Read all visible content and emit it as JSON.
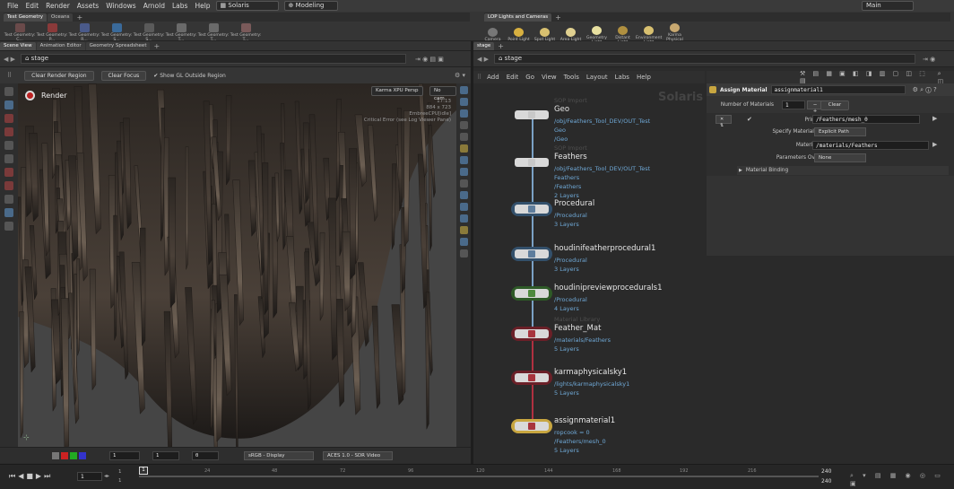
{
  "menubar": {
    "items": [
      "File",
      "Edit",
      "Render",
      "Assets",
      "Windows",
      "Arnold",
      "Labs",
      "Help"
    ],
    "desktop": "Solaris",
    "workspace": "Modeling",
    "right_desktop": "Main"
  },
  "shelf": {
    "left_tabs": [
      "Test Geometry",
      "Oceans"
    ],
    "left_tools": [
      "Test Geometry: C...",
      "Test Geometry: P...",
      "Test Geometry: R...",
      "Test Geometry: S...",
      "Test Geometry: S...",
      "Test Geometry: T...",
      "Test Geometry: T...",
      "Test Geometry: T..."
    ],
    "right_tabs": [
      "LOP Lights and Cameras"
    ],
    "right_tools": [
      "Camera",
      "Point Light",
      "Spot Light",
      "Area Light",
      "Geometry Light",
      "Distant Light",
      "Environment Light",
      "Karma Physical Sky..."
    ]
  },
  "left_pane": {
    "tabs": [
      "Scene View",
      "Animation Editor",
      "Geometry Spreadsheet"
    ],
    "path": "stage",
    "clear_render_region": "Clear Render Region",
    "clear_focus": "Clear Focus",
    "show_gl_outside": "Show GL Outside Region",
    "render_label": "Render",
    "renderer": "Karma XPU  Persp",
    "camera": "No cam",
    "overlay_lines": [
      "17:13",
      "884 x 723",
      "EmbreeCPU[idle]",
      "Critical Error (see Log Viewer Pane)"
    ],
    "bottom": {
      "frame_a": "1",
      "frame_b": "1",
      "frame_c": "0",
      "display": "sRGB - Display",
      "view": "ACES 1.0 - SDR Video"
    }
  },
  "right_pane": {
    "tab": "stage",
    "path": "stage",
    "menu": [
      "Add",
      "Edit",
      "Go",
      "View",
      "Tools",
      "Layout",
      "Labs",
      "Help"
    ],
    "watermark": "Solaris"
  },
  "nodes": [
    {
      "type": "SOP Import",
      "name": "Geo",
      "info": [
        "/obj/Feathers_Tool_DEV/OUT_Test",
        "Geo",
        "/Geo"
      ],
      "color": "#c8c8c8",
      "ring": "none"
    },
    {
      "type": "SOP Import",
      "name": "Feathers",
      "info": [
        "/obj/Feathers_Tool_DEV/OUT_Test",
        "Feathers",
        "/Feathers",
        "2 Layers"
      ],
      "color": "#c8c8c8",
      "ring": "none"
    },
    {
      "type": "",
      "name": "Procedural",
      "info": [
        "/Procedural",
        "3 Layers"
      ],
      "color": "#5e7d9c",
      "ring": "#33506b"
    },
    {
      "type": "",
      "name": "houdinifeatherprocedural1",
      "info": [
        "/Procedural",
        "3 Layers"
      ],
      "color": "#5e7d9c",
      "ring": "#33506b"
    },
    {
      "type": "",
      "name": "houdinipreviewprocedurals1",
      "info": [
        "/Procedural",
        "4 Layers"
      ],
      "color": "#4e8a3e",
      "ring": "#2e5a27"
    },
    {
      "type": "Material Library",
      "name": "Feather_Mat",
      "info": [
        "/materials/Feathers",
        "5 Layers"
      ],
      "color": "#a8343d",
      "ring": "#6b2028"
    },
    {
      "type": "",
      "name": "karmaphysicalsky1",
      "info": [
        "/lights/karmaphysicalsky1",
        "5 Layers"
      ],
      "color": "#a8343d",
      "ring": "#6b2028"
    },
    {
      "type": "",
      "name": "assignmaterial1",
      "info": [
        "ropcook = 0",
        "/Feathers/mesh_0",
        "5 Layers"
      ],
      "color": "#a8343d",
      "ring": "#c8a640"
    }
  ],
  "params": {
    "node_type": "Assign Material",
    "node_name": "assignmaterial1",
    "num_materials_label": "Number of Materials",
    "num_materials": "1",
    "clear": "Clear",
    "primitives_label": "Primitives",
    "primitives": "/Feathers/mesh_0",
    "specify_label": "Specify Material Using",
    "specify": "Explicit Path",
    "material_path_label": "Material Path",
    "material_path": "/materials/Feathers",
    "override_label": "Parameters Override",
    "override": "None",
    "binding": "Material Binding"
  },
  "timeline": {
    "frame": "1",
    "start": "1",
    "start2": "1",
    "marker": "1",
    "ticks": [
      "24",
      "48",
      "72",
      "96",
      "120",
      "144",
      "168",
      "192",
      "216"
    ],
    "end": "240",
    "end2": "240"
  },
  "colors": {
    "accent": "#6fa8d6",
    "wire": "#7ba1c5",
    "red_wire": "#b03040"
  }
}
